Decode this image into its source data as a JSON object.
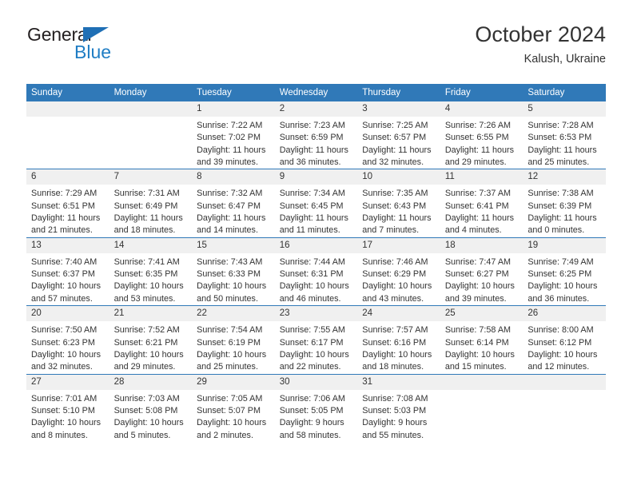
{
  "brand": {
    "name_top": "General",
    "name_bottom": "Blue",
    "triangle_color": "#1f6fb5",
    "blue_color": "#1f7dc4"
  },
  "header": {
    "title": "October 2024",
    "subtitle": "Kalush, Ukraine"
  },
  "theme": {
    "header_bg": "#3079b8",
    "daynum_bg": "#f0f0f0",
    "text": "#333333"
  },
  "calendar": {
    "weekday_headers": [
      "Sunday",
      "Monday",
      "Tuesday",
      "Wednesday",
      "Thursday",
      "Friday",
      "Saturday"
    ],
    "weeks": [
      [
        {
          "day": "",
          "sunrise": "",
          "sunset": "",
          "daylight": "",
          "empty": true
        },
        {
          "day": "",
          "sunrise": "",
          "sunset": "",
          "daylight": "",
          "empty": true
        },
        {
          "day": "1",
          "sunrise": "Sunrise: 7:22 AM",
          "sunset": "Sunset: 7:02 PM",
          "daylight": "Daylight: 11 hours and 39 minutes."
        },
        {
          "day": "2",
          "sunrise": "Sunrise: 7:23 AM",
          "sunset": "Sunset: 6:59 PM",
          "daylight": "Daylight: 11 hours and 36 minutes."
        },
        {
          "day": "3",
          "sunrise": "Sunrise: 7:25 AM",
          "sunset": "Sunset: 6:57 PM",
          "daylight": "Daylight: 11 hours and 32 minutes."
        },
        {
          "day": "4",
          "sunrise": "Sunrise: 7:26 AM",
          "sunset": "Sunset: 6:55 PM",
          "daylight": "Daylight: 11 hours and 29 minutes."
        },
        {
          "day": "5",
          "sunrise": "Sunrise: 7:28 AM",
          "sunset": "Sunset: 6:53 PM",
          "daylight": "Daylight: 11 hours and 25 minutes."
        }
      ],
      [
        {
          "day": "6",
          "sunrise": "Sunrise: 7:29 AM",
          "sunset": "Sunset: 6:51 PM",
          "daylight": "Daylight: 11 hours and 21 minutes."
        },
        {
          "day": "7",
          "sunrise": "Sunrise: 7:31 AM",
          "sunset": "Sunset: 6:49 PM",
          "daylight": "Daylight: 11 hours and 18 minutes."
        },
        {
          "day": "8",
          "sunrise": "Sunrise: 7:32 AM",
          "sunset": "Sunset: 6:47 PM",
          "daylight": "Daylight: 11 hours and 14 minutes."
        },
        {
          "day": "9",
          "sunrise": "Sunrise: 7:34 AM",
          "sunset": "Sunset: 6:45 PM",
          "daylight": "Daylight: 11 hours and 11 minutes."
        },
        {
          "day": "10",
          "sunrise": "Sunrise: 7:35 AM",
          "sunset": "Sunset: 6:43 PM",
          "daylight": "Daylight: 11 hours and 7 minutes."
        },
        {
          "day": "11",
          "sunrise": "Sunrise: 7:37 AM",
          "sunset": "Sunset: 6:41 PM",
          "daylight": "Daylight: 11 hours and 4 minutes."
        },
        {
          "day": "12",
          "sunrise": "Sunrise: 7:38 AM",
          "sunset": "Sunset: 6:39 PM",
          "daylight": "Daylight: 11 hours and 0 minutes."
        }
      ],
      [
        {
          "day": "13",
          "sunrise": "Sunrise: 7:40 AM",
          "sunset": "Sunset: 6:37 PM",
          "daylight": "Daylight: 10 hours and 57 minutes."
        },
        {
          "day": "14",
          "sunrise": "Sunrise: 7:41 AM",
          "sunset": "Sunset: 6:35 PM",
          "daylight": "Daylight: 10 hours and 53 minutes."
        },
        {
          "day": "15",
          "sunrise": "Sunrise: 7:43 AM",
          "sunset": "Sunset: 6:33 PM",
          "daylight": "Daylight: 10 hours and 50 minutes."
        },
        {
          "day": "16",
          "sunrise": "Sunrise: 7:44 AM",
          "sunset": "Sunset: 6:31 PM",
          "daylight": "Daylight: 10 hours and 46 minutes."
        },
        {
          "day": "17",
          "sunrise": "Sunrise: 7:46 AM",
          "sunset": "Sunset: 6:29 PM",
          "daylight": "Daylight: 10 hours and 43 minutes."
        },
        {
          "day": "18",
          "sunrise": "Sunrise: 7:47 AM",
          "sunset": "Sunset: 6:27 PM",
          "daylight": "Daylight: 10 hours and 39 minutes."
        },
        {
          "day": "19",
          "sunrise": "Sunrise: 7:49 AM",
          "sunset": "Sunset: 6:25 PM",
          "daylight": "Daylight: 10 hours and 36 minutes."
        }
      ],
      [
        {
          "day": "20",
          "sunrise": "Sunrise: 7:50 AM",
          "sunset": "Sunset: 6:23 PM",
          "daylight": "Daylight: 10 hours and 32 minutes."
        },
        {
          "day": "21",
          "sunrise": "Sunrise: 7:52 AM",
          "sunset": "Sunset: 6:21 PM",
          "daylight": "Daylight: 10 hours and 29 minutes."
        },
        {
          "day": "22",
          "sunrise": "Sunrise: 7:54 AM",
          "sunset": "Sunset: 6:19 PM",
          "daylight": "Daylight: 10 hours and 25 minutes."
        },
        {
          "day": "23",
          "sunrise": "Sunrise: 7:55 AM",
          "sunset": "Sunset: 6:17 PM",
          "daylight": "Daylight: 10 hours and 22 minutes."
        },
        {
          "day": "24",
          "sunrise": "Sunrise: 7:57 AM",
          "sunset": "Sunset: 6:16 PM",
          "daylight": "Daylight: 10 hours and 18 minutes."
        },
        {
          "day": "25",
          "sunrise": "Sunrise: 7:58 AM",
          "sunset": "Sunset: 6:14 PM",
          "daylight": "Daylight: 10 hours and 15 minutes."
        },
        {
          "day": "26",
          "sunrise": "Sunrise: 8:00 AM",
          "sunset": "Sunset: 6:12 PM",
          "daylight": "Daylight: 10 hours and 12 minutes."
        }
      ],
      [
        {
          "day": "27",
          "sunrise": "Sunrise: 7:01 AM",
          "sunset": "Sunset: 5:10 PM",
          "daylight": "Daylight: 10 hours and 8 minutes."
        },
        {
          "day": "28",
          "sunrise": "Sunrise: 7:03 AM",
          "sunset": "Sunset: 5:08 PM",
          "daylight": "Daylight: 10 hours and 5 minutes."
        },
        {
          "day": "29",
          "sunrise": "Sunrise: 7:05 AM",
          "sunset": "Sunset: 5:07 PM",
          "daylight": "Daylight: 10 hours and 2 minutes."
        },
        {
          "day": "30",
          "sunrise": "Sunrise: 7:06 AM",
          "sunset": "Sunset: 5:05 PM",
          "daylight": "Daylight: 9 hours and 58 minutes."
        },
        {
          "day": "31",
          "sunrise": "Sunrise: 7:08 AM",
          "sunset": "Sunset: 5:03 PM",
          "daylight": "Daylight: 9 hours and 55 minutes."
        },
        {
          "day": "",
          "sunrise": "",
          "sunset": "",
          "daylight": "",
          "empty": true
        },
        {
          "day": "",
          "sunrise": "",
          "sunset": "",
          "daylight": "",
          "empty": true
        }
      ]
    ]
  }
}
